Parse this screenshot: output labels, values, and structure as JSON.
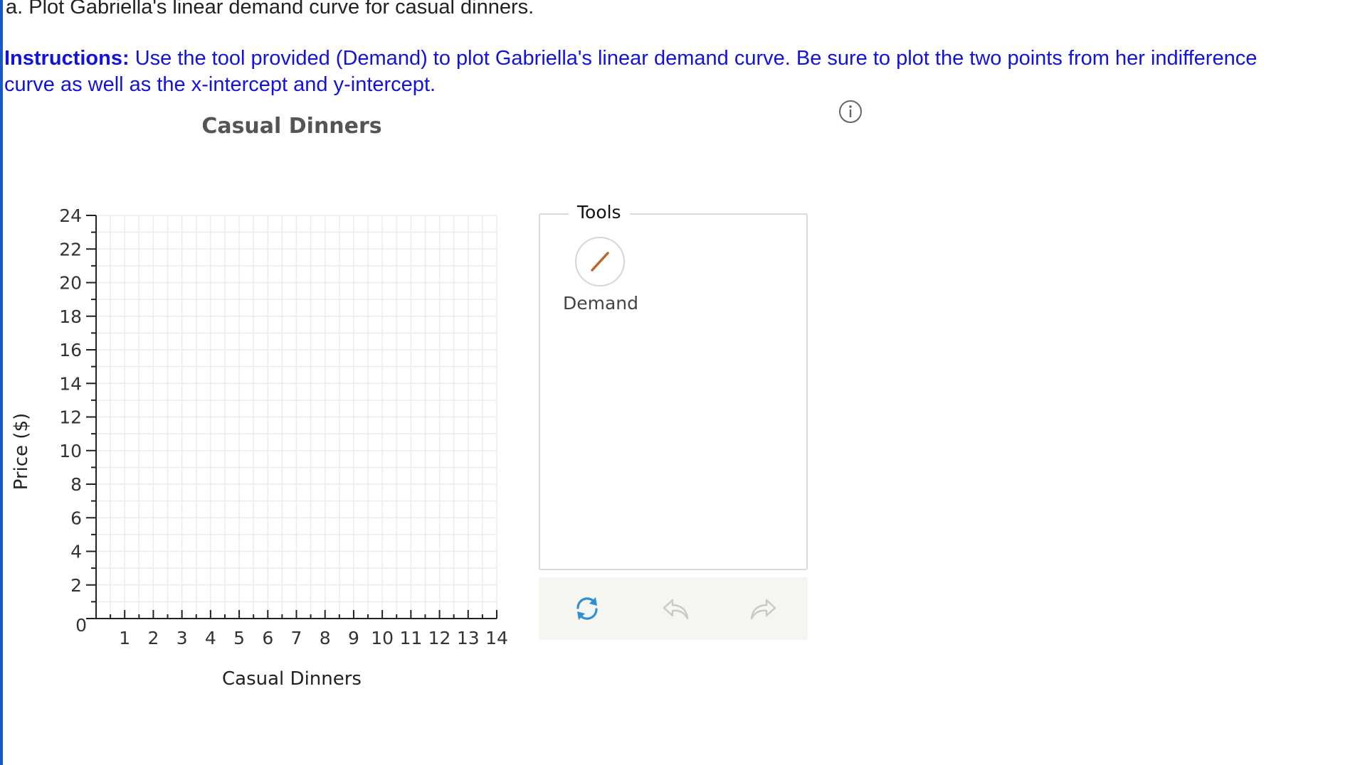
{
  "question": "a. Plot Gabriella's linear demand curve for casual dinners.",
  "instructions": {
    "label": "Instructions:",
    "text": "Use the tool provided (Demand) to plot Gabriella's linear demand curve. Be sure to plot the two points from her indifference curve as well as the x-intercept and y-intercept."
  },
  "chart_data": {
    "type": "scatter",
    "title": "Casual Dinners",
    "xlabel": "Casual Dinners",
    "ylabel": "Price ($)",
    "xlim": [
      0,
      14
    ],
    "ylim": [
      0,
      24
    ],
    "x_ticks": [
      "1",
      "2",
      "3",
      "4",
      "5",
      "6",
      "7",
      "8",
      "9",
      "10",
      "11",
      "12",
      "13",
      "14"
    ],
    "y_ticks": [
      "0",
      "2",
      "4",
      "6",
      "8",
      "10",
      "12",
      "14",
      "16",
      "18",
      "20",
      "22",
      "24"
    ],
    "grid": true,
    "series": []
  },
  "tools": {
    "legend": "Tools",
    "items": [
      {
        "label": "Demand",
        "icon": "line-tool-icon",
        "color": "#c0632a"
      }
    ]
  },
  "actions": {
    "reset_icon": "refresh-icon",
    "undo_icon": "undo-icon",
    "redo_icon": "redo-icon",
    "accent": "#2f8fd3"
  }
}
